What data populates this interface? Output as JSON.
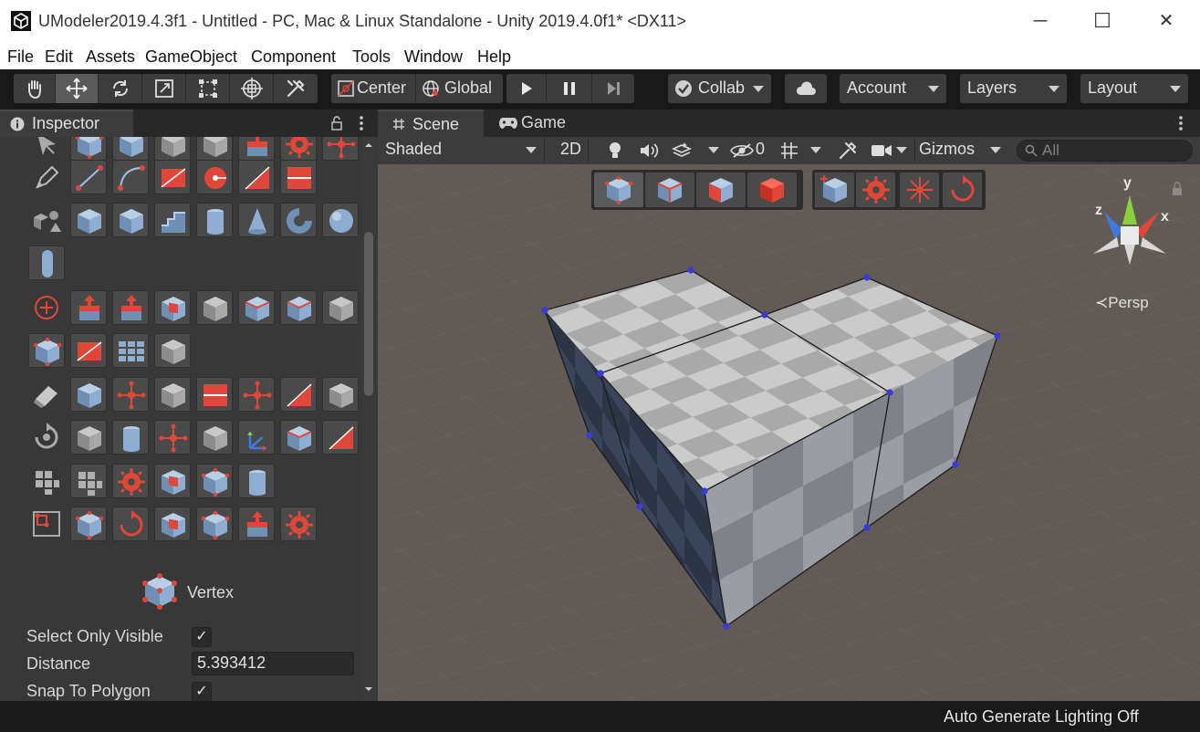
{
  "window": {
    "title": "UModeler2019.4.3f1 - Untitled - PC, Mac & Linux Standalone - Unity 2019.4.0f1* <DX11>",
    "minimize": "─",
    "maximize": "☐",
    "close": "✕"
  },
  "menu": [
    "File",
    "Edit",
    "Assets",
    "GameObject",
    "Component",
    "Tools",
    "Window",
    "Help"
  ],
  "toolbar": {
    "pivot_mode": "Center",
    "pivot_rotation": "Global",
    "collab": "Collab",
    "account": "Account",
    "layers": "Layers",
    "layout": "Layout"
  },
  "inspector": {
    "tab_label": "Inspector",
    "selection_mode_label": "Vertex",
    "props": {
      "select_only_visible": {
        "label": "Select Only Visible",
        "checked": "✓"
      },
      "distance": {
        "label": "Distance",
        "value": "5.393412"
      },
      "snap_to_polygon": {
        "label": "Snap To Polygon",
        "checked": "✓"
      }
    }
  },
  "scene": {
    "tabs": {
      "scene": "Scene",
      "game": "Game"
    },
    "shading_mode": "Shaded",
    "two_d": "2D",
    "hidden_count": "0",
    "gizmos": "Gizmos",
    "search_placeholder": "All",
    "projection_label": "≺Persp",
    "axis": {
      "x": "x",
      "y": "y",
      "z": "z"
    }
  },
  "status": {
    "text": "Auto Generate Lighting Off"
  },
  "colors": {
    "accent_red": "#e0473a",
    "vertex_blue": "#3a3adc",
    "panel": "#383838",
    "scene_bg": "#5f5a55"
  }
}
